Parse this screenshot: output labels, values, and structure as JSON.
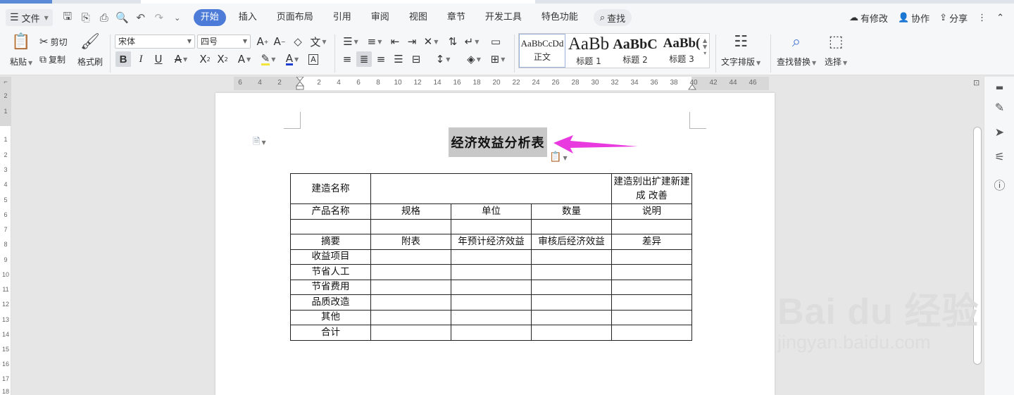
{
  "menu": {
    "file_label": "文件",
    "tabs": [
      "开始",
      "插入",
      "页面布局",
      "引用",
      "审阅",
      "视图",
      "章节",
      "开发工具",
      "特色功能"
    ],
    "search_label": "查找",
    "right": {
      "modified": "有修改",
      "collab": "协作",
      "share": "分享"
    }
  },
  "ribbon": {
    "paste": "粘贴",
    "cut": "剪切",
    "copy": "复制",
    "format_painter": "格式刷",
    "font_name": "宋体",
    "font_size": "四号",
    "bold": "B",
    "italic": "I",
    "underline": "U",
    "styles": [
      {
        "preview": "AaBbCcDd",
        "name": "正文"
      },
      {
        "preview": "AaBb",
        "name": "标题 1"
      },
      {
        "preview": "AaBbC",
        "name": "标题 2"
      },
      {
        "preview": "AaBb(",
        "name": "标题 3"
      }
    ],
    "text_layout": "文字排版",
    "find_replace": "查找替换",
    "select": "选择"
  },
  "ruler": {
    "h_labels": [
      "6",
      "4",
      "2",
      "2",
      "4",
      "6",
      "8",
      "10",
      "12",
      "14",
      "16",
      "18",
      "20",
      "22",
      "24",
      "26",
      "28",
      "30",
      "32",
      "34",
      "36",
      "38",
      "40",
      "42",
      "44",
      "46"
    ],
    "v_labels": [
      "2",
      "1",
      "1",
      "2",
      "3",
      "4",
      "5",
      "6",
      "7",
      "8",
      "9",
      "10",
      "11",
      "12",
      "13",
      "14",
      "15",
      "16",
      "17",
      "18"
    ]
  },
  "document": {
    "title": "经济效益分析表",
    "table": {
      "row1": {
        "c1": "建造名称",
        "c2": "",
        "c3": "建造别出扩建新建成 改善"
      },
      "row2": [
        "产品名称",
        "规格",
        "单位",
        "数量",
        "说明"
      ],
      "row3": [
        "",
        "",
        "",
        "",
        ""
      ],
      "row4": [
        "摘要",
        "附表",
        "年预计经济效益",
        "审核后经济效益",
        "差异"
      ],
      "rows": [
        [
          "收益项目",
          "",
          "",
          "",
          ""
        ],
        [
          "节省人工",
          "",
          "",
          "",
          ""
        ],
        [
          "节省费用",
          "",
          "",
          "",
          ""
        ],
        [
          "品质改造",
          "",
          "",
          "",
          ""
        ],
        [
          "其他",
          "",
          "",
          "",
          ""
        ],
        [
          "合计",
          "",
          "",
          "",
          ""
        ]
      ]
    }
  },
  "watermark": {
    "main": "Bai du 经验",
    "sub": "jingyan.baidu.com"
  },
  "colors": {
    "accent": "#4d7cd8",
    "arrow": "#e83adf"
  }
}
